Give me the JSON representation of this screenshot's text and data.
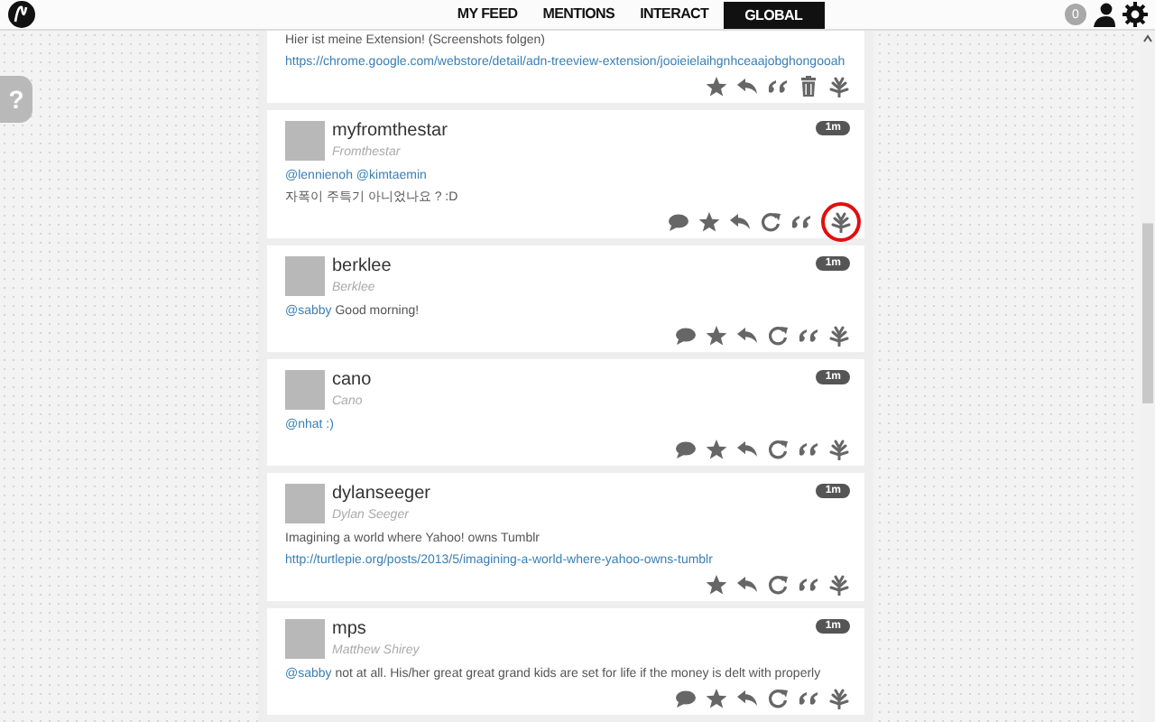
{
  "topbar": {
    "tabs": [
      {
        "label": "MY FEED",
        "selected": false
      },
      {
        "label": "MENTIONS",
        "selected": false
      },
      {
        "label": "INTERACT",
        "selected": false
      },
      {
        "label": "GLOBAL",
        "selected": true
      }
    ],
    "unread_count": "0"
  },
  "help_tab": "?",
  "posts": [
    {
      "lines": [
        {
          "kind": "text",
          "text": "Hier ist meine Extension! (Screenshots folgen)"
        },
        {
          "kind": "link",
          "text": "https://chrome.google.com/webstore/detail/adn-treeview-extension/jooieielaihgnhceaajobghongooah"
        }
      ],
      "actions": [
        {
          "kind": "star",
          "highlighted": false
        },
        {
          "kind": "reply",
          "highlighted": false
        },
        {
          "kind": "quote",
          "highlighted": false
        },
        {
          "kind": "delete",
          "highlighted": false
        },
        {
          "kind": "patter",
          "highlighted": false
        }
      ]
    },
    {
      "username": "myfromthestar",
      "display_name": "Fromthestar",
      "time": "1m",
      "lines": [
        {
          "kind": "mentions",
          "text": "@lennienoh @kimtaemin"
        },
        {
          "kind": "text",
          "text": "자폭이 주특기 아니었나요 ? :D"
        }
      ],
      "actions": [
        {
          "kind": "conversation",
          "highlighted": false
        },
        {
          "kind": "star",
          "highlighted": false
        },
        {
          "kind": "reply",
          "highlighted": false
        },
        {
          "kind": "repost",
          "highlighted": false
        },
        {
          "kind": "quote",
          "highlighted": false
        },
        {
          "kind": "patter",
          "highlighted": true
        }
      ]
    },
    {
      "username": "berklee",
      "display_name": "Berklee",
      "time": "1m",
      "lines": [
        {
          "kind": "mixed",
          "mention": "@sabby",
          "text": "Good morning!"
        }
      ],
      "actions": [
        {
          "kind": "conversation",
          "highlighted": false
        },
        {
          "kind": "star",
          "highlighted": false
        },
        {
          "kind": "reply",
          "highlighted": false
        },
        {
          "kind": "repost",
          "highlighted": false
        },
        {
          "kind": "quote",
          "highlighted": false
        },
        {
          "kind": "patter",
          "highlighted": false
        }
      ]
    },
    {
      "username": "cano",
      "display_name": "Cano",
      "time": "1m",
      "lines": [
        {
          "kind": "mentions",
          "text": "@nhat :)"
        }
      ],
      "actions": [
        {
          "kind": "conversation",
          "highlighted": false
        },
        {
          "kind": "star",
          "highlighted": false
        },
        {
          "kind": "reply",
          "highlighted": false
        },
        {
          "kind": "repost",
          "highlighted": false
        },
        {
          "kind": "quote",
          "highlighted": false
        },
        {
          "kind": "patter",
          "highlighted": false
        }
      ]
    },
    {
      "username": "dylanseeger",
      "display_name": "Dylan Seeger",
      "time": "1m",
      "lines": [
        {
          "kind": "text",
          "text": "Imagining a world where Yahoo! owns Tumblr"
        },
        {
          "kind": "link",
          "text": "http://turtlepie.org/posts/2013/5/imagining-a-world-where-yahoo-owns-tumblr"
        }
      ],
      "actions": [
        {
          "kind": "star",
          "highlighted": false
        },
        {
          "kind": "reply",
          "highlighted": false
        },
        {
          "kind": "repost",
          "highlighted": false
        },
        {
          "kind": "quote",
          "highlighted": false
        },
        {
          "kind": "patter",
          "highlighted": false
        }
      ]
    },
    {
      "username": "mps",
      "display_name": "Matthew Shirey",
      "time": "1m",
      "lines": [
        {
          "kind": "mixed",
          "mention": "@sabby",
          "text": "not at all. His/her great great grand kids are set for life if the money is delt with properly"
        }
      ],
      "actions": [
        {
          "kind": "conversation",
          "highlighted": false
        },
        {
          "kind": "star",
          "highlighted": false
        },
        {
          "kind": "reply",
          "highlighted": false
        },
        {
          "kind": "repost",
          "highlighted": false
        },
        {
          "kind": "quote",
          "highlighted": false
        },
        {
          "kind": "patter",
          "highlighted": false
        }
      ]
    }
  ]
}
